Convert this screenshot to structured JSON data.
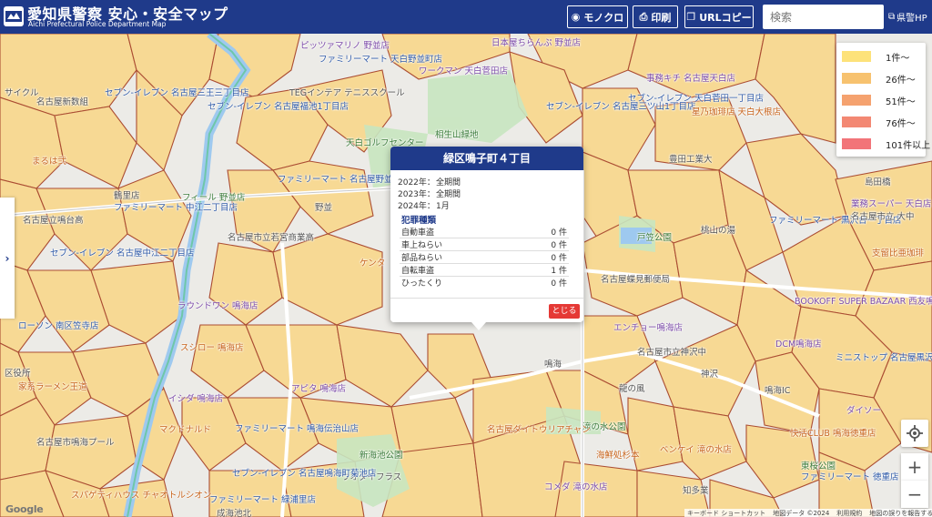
{
  "header": {
    "title": "愛知県警察 安心・安全マップ",
    "subtitle": "Aichi Prefectural Police Department Map",
    "mono_label": "モノクロ",
    "print_label": "印刷",
    "url_copy_label": "URLコピー",
    "search_placeholder": "検索",
    "hp_label": "県警HP"
  },
  "legend": [
    {
      "label": "1件～",
      "color": "#fde27a"
    },
    {
      "label": "26件～",
      "color": "#f7c26f"
    },
    {
      "label": "51件～",
      "color": "#f5a26f"
    },
    {
      "label": "76件～",
      "color": "#f38873"
    },
    {
      "label": "101件以上",
      "color": "#f27479"
    }
  ],
  "popup": {
    "title": "緑区鳴子町４丁目",
    "periods": [
      {
        "year": "2022年：",
        "value": "全期間"
      },
      {
        "year": "2023年：",
        "value": "全期間"
      },
      {
        "year": "2024年：",
        "value": "1月"
      }
    ],
    "crime_heading": "犯罪種類",
    "crimes": [
      {
        "name": "自動車盗",
        "count": "0 件"
      },
      {
        "name": "車上ねらい",
        "count": "0 件"
      },
      {
        "name": "部品ねらい",
        "count": "0 件"
      },
      {
        "name": "自転車盗",
        "count": "1 件"
      },
      {
        "name": "ひったくり",
        "count": "0 件"
      }
    ],
    "close_label": "とじる"
  },
  "map_labels": [
    {
      "text": "ピッツァマリノ 野並店",
      "cls": "purple"
    },
    {
      "text": "日本屋ちらんぷ 野並店",
      "cls": "purple"
    },
    {
      "text": "ファミリーマート 天白野並町店",
      "cls": "blue"
    },
    {
      "text": "ワークマン 天白菅田店",
      "cls": "purple"
    },
    {
      "text": "事務キチ 名古屋天白店",
      "cls": "purple"
    },
    {
      "text": "サイクル",
      "cls": "gray"
    },
    {
      "text": "セブン-イレブン 名古屋三王三丁目店",
      "cls": "blue"
    },
    {
      "text": "セブン-イレブン 天白菅田一丁目店",
      "cls": "blue"
    },
    {
      "text": "TEGインテア テニススクール",
      "cls": "gray"
    },
    {
      "text": "セブン-イレブン 名古屋福池1丁目店",
      "cls": "blue"
    },
    {
      "text": "セブン-イレブン 名古屋三ツ山1丁目店",
      "cls": "blue"
    },
    {
      "text": "名古屋新数組",
      "cls": "gray"
    },
    {
      "text": "相生山緑地",
      "cls": "green"
    },
    {
      "text": "星乃珈琲店 天白大根店",
      "cls": "orange"
    },
    {
      "text": "天白ゴルフセンター",
      "cls": "green"
    },
    {
      "text": "まるは弐",
      "cls": "orange"
    },
    {
      "text": "鶴里店",
      "cls": "gray"
    },
    {
      "text": "ファミリーマート 名古屋野並二丁目店",
      "cls": "blue"
    },
    {
      "text": "フィール 野並店",
      "cls": "green"
    },
    {
      "text": "ファミリーマート 中江二丁目店",
      "cls": "blue"
    },
    {
      "text": "名古屋立鳴台高",
      "cls": "gray"
    },
    {
      "text": "名古屋市立若宮商業高",
      "cls": "gray"
    },
    {
      "text": "戸笠公園",
      "cls": "green"
    },
    {
      "text": "桃山の湯",
      "cls": "gray"
    },
    {
      "text": "ファミリーマート 黒沢台一丁目店",
      "cls": "blue"
    },
    {
      "text": "支留比亜珈琲",
      "cls": "orange"
    },
    {
      "text": "セブン-イレブン 名古屋中江二丁目店",
      "cls": "blue"
    },
    {
      "text": "ケンタ",
      "cls": "orange"
    },
    {
      "text": "名古屋蝶見郵便局",
      "cls": "gray"
    },
    {
      "text": "ラウンドワン 鳴海店",
      "cls": "purple"
    },
    {
      "text": "ローソン 南区笠寺店",
      "cls": "blue"
    },
    {
      "text": "BOOKOFF SUPER BAZAAR 西友鳴海店",
      "cls": "purple"
    },
    {
      "text": "エンチョー鳴海店",
      "cls": "purple"
    },
    {
      "text": "名古屋市立神沢中",
      "cls": "gray"
    },
    {
      "text": "DCM鳴海店",
      "cls": "purple"
    },
    {
      "text": "ミニストップ 名古屋黒沢台店",
      "cls": "blue"
    },
    {
      "text": "スシロー 鳴海店",
      "cls": "orange"
    },
    {
      "text": "区役所",
      "cls": "gray"
    },
    {
      "text": "家系ラーメン王道",
      "cls": "orange"
    },
    {
      "text": "アピタ 鳴海店",
      "cls": "purple"
    },
    {
      "text": "神沢",
      "cls": "gray"
    },
    {
      "text": "イシダ 鳴海店",
      "cls": "purple"
    },
    {
      "text": "鳴海IC",
      "cls": "gray"
    },
    {
      "text": "ダイソー",
      "cls": "purple"
    },
    {
      "text": "龍の風",
      "cls": "gray"
    },
    {
      "text": "ファミリーマート 鳴海伝治山店",
      "cls": "blue"
    },
    {
      "text": "マクドナルド",
      "cls": "orange"
    },
    {
      "text": "名古屋市鳴海プール",
      "cls": "gray"
    },
    {
      "text": "滝の水公園",
      "cls": "green"
    },
    {
      "text": "名古屋ダイトウリアチャン",
      "cls": "orange"
    },
    {
      "text": "海鮮処杉本",
      "cls": "orange"
    },
    {
      "text": "ベンケイ 滝の水店",
      "cls": "orange"
    },
    {
      "text": "快活CLUB 鳴海徳重店",
      "cls": "orange"
    },
    {
      "text": "新海池公園",
      "cls": "green"
    },
    {
      "text": "ウオダイフラス",
      "cls": "gray"
    },
    {
      "text": "セブン-イレブン 名古屋鳴海町菊池店",
      "cls": "blue"
    },
    {
      "text": "スパゲティハウス チャオトルシオン",
      "cls": "orange"
    },
    {
      "text": "ファミリーマート 緑浦里店",
      "cls": "blue"
    },
    {
      "text": "成海池北",
      "cls": "gray"
    },
    {
      "text": "知多業",
      "cls": "gray"
    },
    {
      "text": "コメダ 滝の水店",
      "cls": "purple"
    },
    {
      "text": "東桜公園",
      "cls": "green"
    },
    {
      "text": "ファミリーマート 徳重店",
      "cls": "blue"
    },
    {
      "text": "業務スーパー 天白店",
      "cls": "purple"
    },
    {
      "text": "名古屋市立 大中",
      "cls": "gray"
    },
    {
      "text": "島田橋",
      "cls": "gray"
    },
    {
      "text": "豊田工業大",
      "cls": "gray"
    },
    {
      "text": "野並",
      "cls": "gray"
    },
    {
      "text": "鳴海",
      "cls": "gray"
    }
  ],
  "map_footer": {
    "google": "Google",
    "attribution": [
      "キーボード ショートカット",
      "地図データ ©2024",
      "利用規約",
      "地図の誤りを報告する"
    ]
  }
}
